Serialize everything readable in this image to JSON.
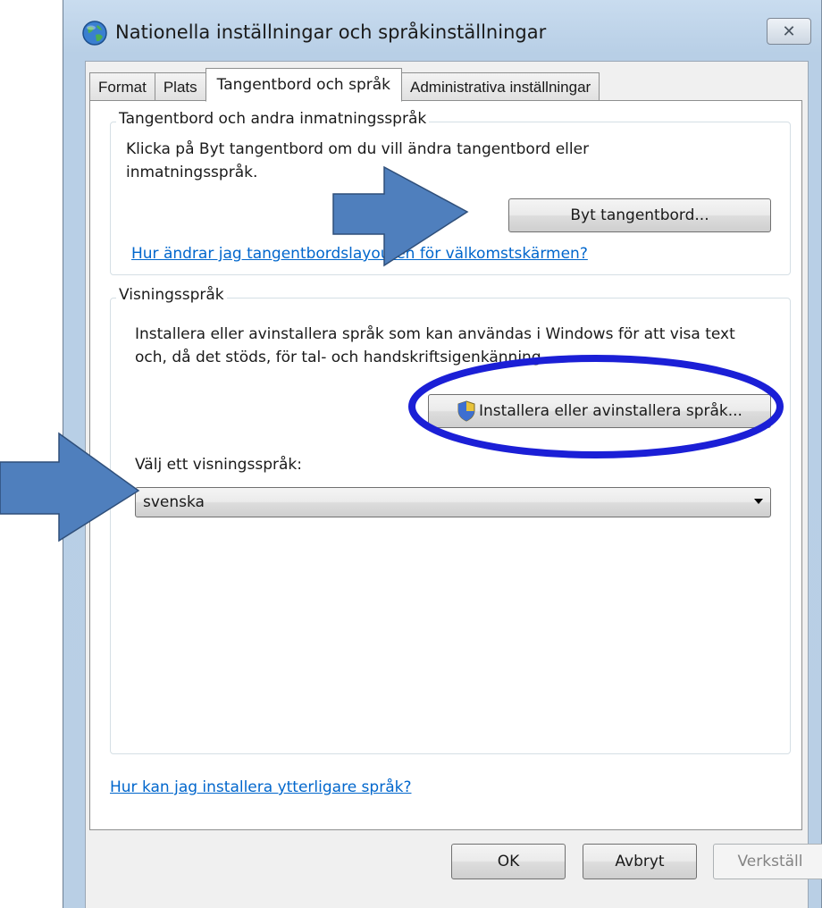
{
  "window": {
    "title": "Nationella inställningar och språkinställningar",
    "close_label": "✕"
  },
  "tabs": [
    {
      "label": "Format"
    },
    {
      "label": "Plats"
    },
    {
      "label": "Tangentbord och språk",
      "active": true
    },
    {
      "label": "Administrativa inställningar"
    }
  ],
  "keyboard_group": {
    "label": "Tangentbord och andra inmatningsspråk",
    "description": "Klicka på Byt tangentbord om du vill ändra tangentbord eller inmatningsspråk.",
    "change_button": "Byt tangentbord...",
    "welcome_link": "Hur ändrar jag tangentbordslayouten för välkomstskärmen?"
  },
  "display_group": {
    "label": "Visningsspråk",
    "description": "Installera eller avinstallera språk som kan användas i Windows för att visa text och, då det stöds, för tal- och handskriftsigenkänning.",
    "install_button": "Installera eller avinstallera språk...",
    "choose_label": "Välj ett visningsspråk:",
    "selected_language": "svenska"
  },
  "more_languages_link": "Hur kan jag installera ytterligare språk?",
  "footer": {
    "ok": "OK",
    "cancel": "Avbryt",
    "apply": "Verkställ"
  },
  "annotations": {
    "arrow_color": "#4f7fbd",
    "circle_color": "#1b1fd6"
  }
}
